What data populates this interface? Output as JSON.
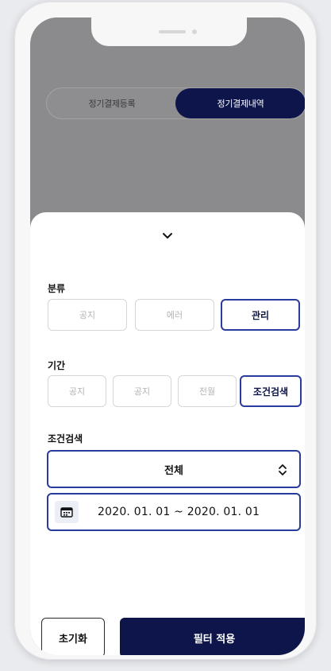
{
  "segment": {
    "left_label": "정기결제등록",
    "right_label": "정기결제내역",
    "selected": "정기결제내역"
  },
  "filter": {
    "category": {
      "label": "분류",
      "options": [
        "공지",
        "에러",
        "관리"
      ],
      "selected": "관리"
    },
    "period": {
      "label": "기간",
      "options": [
        "공지",
        "공지",
        "전월",
        "조건검색"
      ],
      "selected": "조건검색"
    },
    "condition": {
      "label": "조건검색",
      "select_value": "전체",
      "date_range": "2020. 01. 01 ~ 2020. 01. 01"
    },
    "reset_label": "초기화",
    "apply_label": "필터 적용"
  },
  "icons": [
    "chevron-down-icon",
    "chevron-up-down-icon",
    "calendar-icon"
  ],
  "colors": {
    "accent": "#0d154a",
    "active_border": "#2a3b9e",
    "inactive_text": "#b3b3b6"
  }
}
